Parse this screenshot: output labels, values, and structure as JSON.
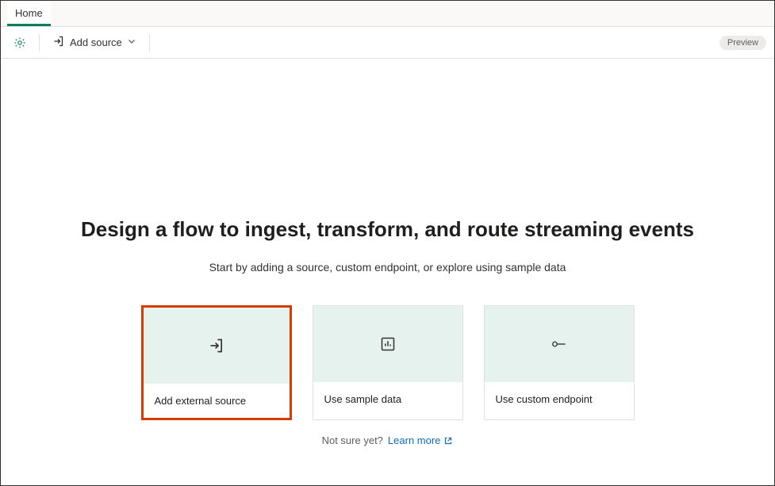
{
  "tabs": {
    "home": "Home"
  },
  "toolbar": {
    "add_source_label": "Add source",
    "preview_badge": "Preview"
  },
  "main": {
    "title": "Design a flow to ingest, transform, and route streaming events",
    "subtitle": "Start by adding a source, custom endpoint, or explore using sample data"
  },
  "cards": {
    "external_source": "Add external source",
    "sample_data": "Use sample data",
    "custom_endpoint": "Use custom endpoint"
  },
  "footer": {
    "prompt": "Not sure yet?",
    "link": "Learn more"
  }
}
